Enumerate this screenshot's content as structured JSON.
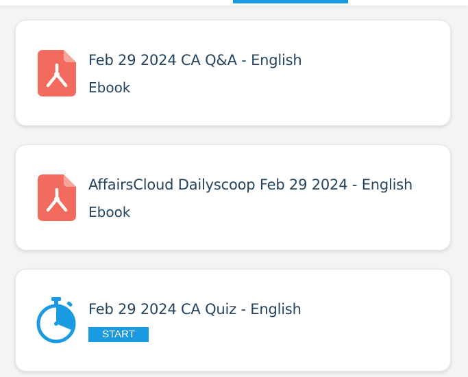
{
  "colors": {
    "accent": "#1a9ae0",
    "pdf_red": "#f26b5e",
    "text": "#24435f"
  },
  "items": [
    {
      "title": "Feb 29 2024 CA Q&A - English",
      "subtitle": "Ebook",
      "icon": "pdf-icon"
    },
    {
      "title": "AffairsCloud Dailyscoop Feb 29 2024 - English",
      "subtitle": "Ebook",
      "icon": "pdf-icon"
    },
    {
      "title": "Feb 29 2024 CA Quiz - English",
      "action_label": "START",
      "icon": "stopwatch-icon"
    }
  ]
}
